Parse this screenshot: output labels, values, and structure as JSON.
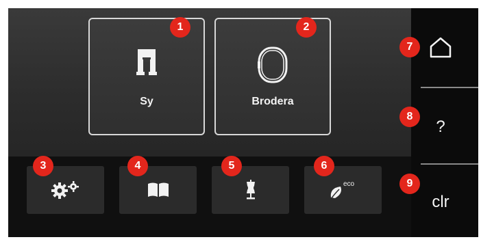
{
  "main": {
    "tiles": [
      {
        "label": "Sy",
        "icon": "presser-foot-icon"
      },
      {
        "label": "Brodera",
        "icon": "embroidery-hoop-icon"
      }
    ]
  },
  "function_bar": [
    {
      "icon": "settings-gears-icon"
    },
    {
      "icon": "guide-book-icon"
    },
    {
      "icon": "dress-form-icon"
    },
    {
      "icon": "eco-leaf-icon",
      "text": "eco"
    }
  ],
  "sidebar": {
    "home_icon": "home-icon",
    "help_label": "?",
    "clear_label": "clr"
  },
  "callouts": [
    "1",
    "2",
    "3",
    "4",
    "5",
    "6",
    "7",
    "8",
    "9"
  ],
  "colors": {
    "callout": "#e3261c",
    "screen": "#0b0b0b",
    "tile_border": "#d8d8d8"
  }
}
